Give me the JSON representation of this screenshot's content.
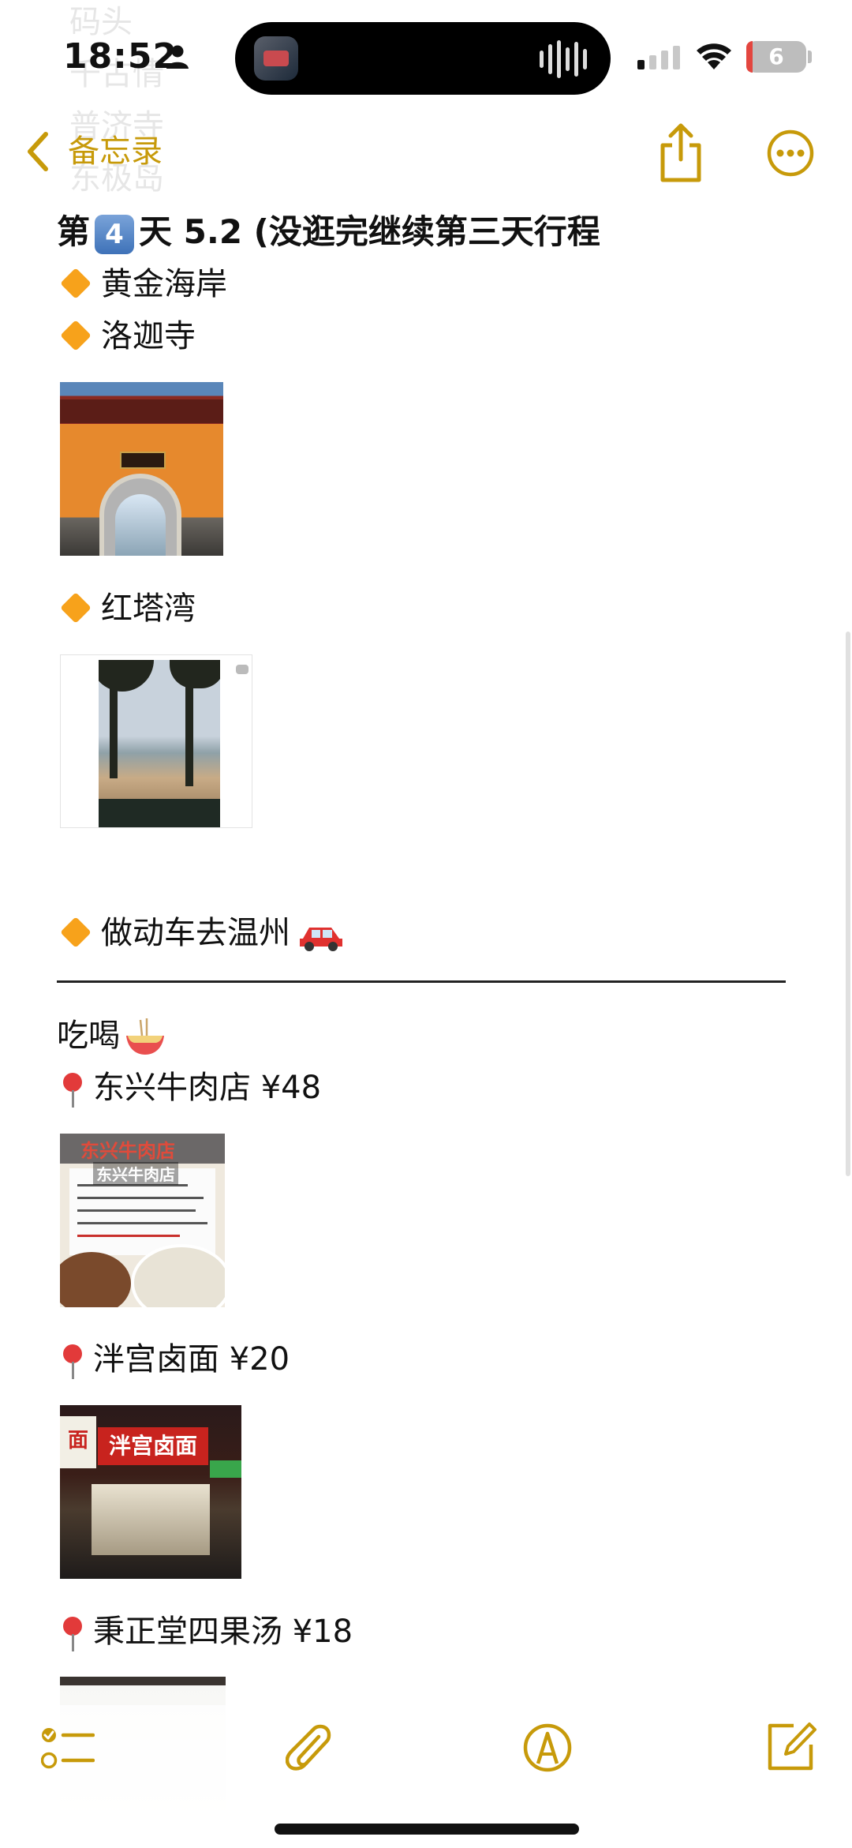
{
  "status_bar": {
    "time": "18:52",
    "battery_label": "6",
    "battery_level_percent": 6,
    "icons": [
      "person-icon",
      "signal-icon",
      "wifi-icon",
      "battery-icon"
    ]
  },
  "nav": {
    "back_label": "备忘录",
    "share_icon": "share-icon",
    "more_icon": "more-icon"
  },
  "colors": {
    "accent": "#c79a0a",
    "diamond": "#f7a21b",
    "pin": "#e23a3a",
    "battery_low": "#e3463f"
  },
  "note": {
    "ghost_lines": [
      "码头",
      "千古情",
      "普济寺",
      "东极岛"
    ],
    "day_heading": {
      "prefix": "第",
      "keycap": "4",
      "suffix": "天 5.2 (没逛完继续第三天行程"
    },
    "items": [
      {
        "label": "黄金海岸"
      },
      {
        "label": "洛迦寺"
      },
      {
        "label": "红塔湾"
      },
      {
        "label": "做动车去温州"
      }
    ],
    "food_heading": "吃喝",
    "restaurants": [
      {
        "label": "东兴牛肉店 ¥48"
      },
      {
        "label": "泮宫卤面 ¥20"
      },
      {
        "label": "秉正堂四果汤 ¥18"
      }
    ],
    "image_text": {
      "beef_sign": "东兴牛肉店",
      "beef_caption": "东兴牛肉店",
      "noodle_sign": "泮宫卤面",
      "noodle_side": "面"
    }
  },
  "toolbar": {
    "icons": [
      "checklist-icon",
      "paperclip-icon",
      "pen-icon",
      "compose-icon"
    ]
  }
}
